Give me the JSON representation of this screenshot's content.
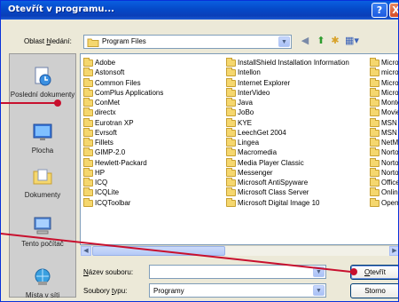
{
  "window": {
    "title": "Otevřít v programu...",
    "help_button": "?",
    "close_button": "X"
  },
  "lookin": {
    "label_pre": "Oblast ",
    "label_accel": "h",
    "label_post": "ledání:",
    "value": "Program Files"
  },
  "places": [
    {
      "label": "Poslední dokumenty",
      "icon": "recent-documents-icon"
    },
    {
      "label": "Plocha",
      "icon": "desktop-icon"
    },
    {
      "label": "Dokumenty",
      "icon": "my-documents-icon"
    },
    {
      "label": "Tento počítač",
      "icon": "my-computer-icon"
    },
    {
      "label": "Místa v síti",
      "icon": "network-places-icon"
    }
  ],
  "files": {
    "col1": [
      "Adobe",
      "Astonsoft",
      "Common Files",
      "ComPlus Applications",
      "ConMet",
      "directx",
      "Eurotran XP",
      "Evrsoft",
      "Fillets",
      "GIMP-2.0",
      "Hewlett-Packard",
      "HP",
      "ICQ",
      "ICQLite",
      "ICQToolbar"
    ],
    "col2": [
      "InstallShield Installation Information",
      "Intellon",
      "Internet Explorer",
      "InterVideo",
      "Java",
      "JoBo",
      "KYE",
      "LeechGet 2004",
      "Lingea",
      "Macromedia",
      "Media Player Classic",
      "Messenger",
      "Microsoft AntiSpyware",
      "Microsoft Class Server",
      "Microsoft Digital Image 10"
    ],
    "col3": [
      "Micros",
      "micros",
      "Micros",
      "Micros",
      "Monte",
      "Movie",
      "MSN",
      "MSN G",
      "NetMe",
      "Norto",
      "Norto",
      "Norto",
      "Office",
      "Online",
      "Open"
    ]
  },
  "filename": {
    "label_pre": "",
    "label_accel": "N",
    "label_post": "ázev souboru:",
    "value": ""
  },
  "filetype": {
    "label_pre": "Soubory ",
    "label_accel": "t",
    "label_post": "ypu:",
    "value": "Programy"
  },
  "buttons": {
    "open_accel": "O",
    "open_post": "tevřít",
    "cancel": "Storno"
  },
  "colors": {
    "titlebar": "#0a5fe0",
    "annotation": "#c8102e"
  }
}
